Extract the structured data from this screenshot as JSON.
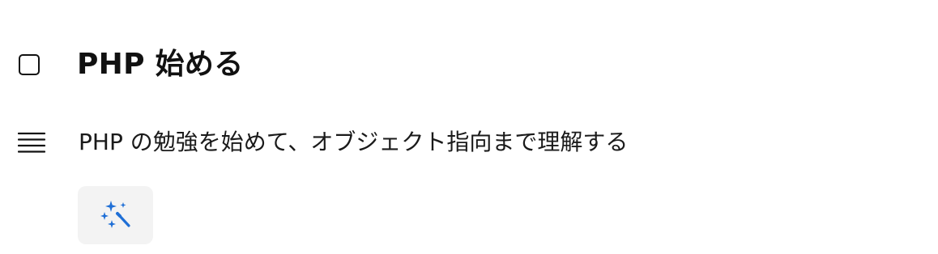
{
  "task": {
    "title": "PHP 始める",
    "completed": false,
    "description": "PHP の勉強を始めて、オブジェクト指向まで理解する"
  },
  "icons": {
    "checkbox": "checkbox-unchecked",
    "description": "text-lines-icon",
    "magic": "magic-wand-sparkles-icon"
  },
  "colors": {
    "text": "#111111",
    "accent": "#1f6fd6",
    "button_background": "#f3f3f3"
  }
}
